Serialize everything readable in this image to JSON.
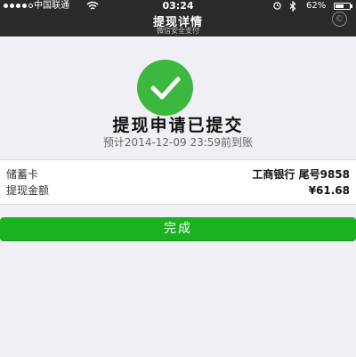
{
  "status_bar": {
    "carrier": "中国联通",
    "time": "03:24",
    "battery_percent": "62%",
    "battery_level": 0.62,
    "signal_bars_filled": 4,
    "signal_bars_total": 5,
    "icons": [
      "signal-dots-icon",
      "wifi-icon",
      "alarm-icon",
      "bluetooth-icon",
      "battery-icon"
    ]
  },
  "nav": {
    "title": "提现详情",
    "subtitle": "微信安全支付",
    "corner_icon": "©"
  },
  "result": {
    "icon": "check-circle-icon",
    "title": "提现申请已提交",
    "subtitle": "预计2014-12-09 23:59前到账"
  },
  "details": [
    {
      "label": "储蓄卡",
      "value": "工商银行 尾号9858"
    },
    {
      "label": "提现金额",
      "value": "¥61.68"
    }
  ],
  "actions": {
    "done_label": "完成"
  },
  "colors": {
    "topbar": "#2b2b2b",
    "background": "#f0eff5",
    "success_green": "#3db83f",
    "button_green": "#1ab31f"
  }
}
